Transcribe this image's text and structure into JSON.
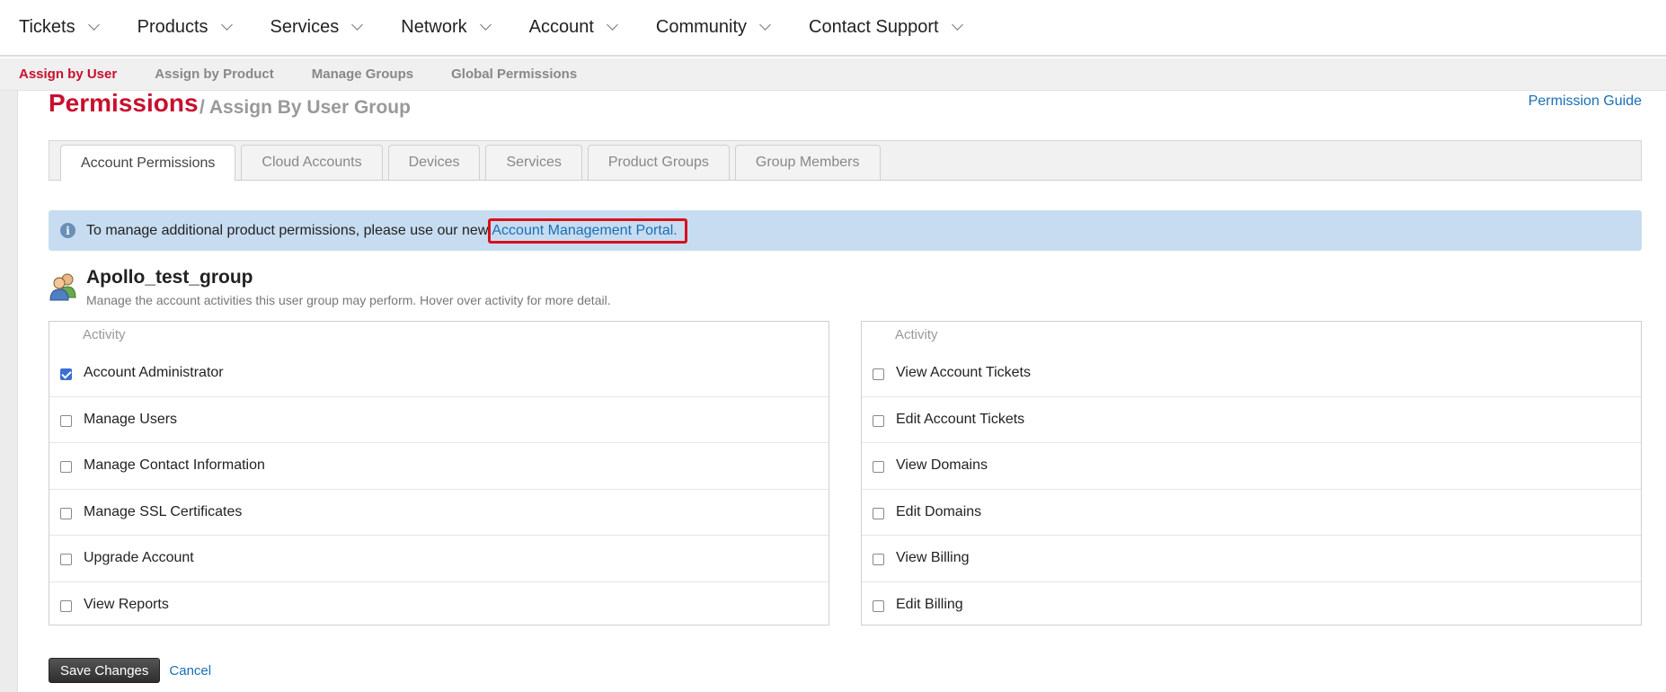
{
  "topnav": {
    "items": [
      {
        "label": "Tickets"
      },
      {
        "label": "Products"
      },
      {
        "label": "Services"
      },
      {
        "label": "Network"
      },
      {
        "label": "Account"
      },
      {
        "label": "Community"
      },
      {
        "label": "Contact Support"
      }
    ]
  },
  "subnav": {
    "items": [
      {
        "label": "Assign by User",
        "active": true
      },
      {
        "label": "Assign by Product"
      },
      {
        "label": "Manage Groups"
      },
      {
        "label": "Global Permissions"
      }
    ]
  },
  "page": {
    "title": "Permissions",
    "subtitle": "/ Assign By User Group",
    "guide_link": "Permission Guide"
  },
  "tabs": [
    {
      "label": "Account Permissions",
      "active": true
    },
    {
      "label": "Cloud Accounts"
    },
    {
      "label": "Devices"
    },
    {
      "label": "Services"
    },
    {
      "label": "Product Groups"
    },
    {
      "label": "Group Members"
    }
  ],
  "info": {
    "icon": "info-icon",
    "text": "To manage additional product permissions, please use our new",
    "link": "Account Management Portal."
  },
  "group": {
    "name": "Apollo_test_group",
    "description": "Manage the account activities this user group may perform. Hover over activity for more detail."
  },
  "left_panel": {
    "header": "Activity",
    "rows": [
      {
        "label": "Account Administrator",
        "checked": true
      },
      {
        "label": "Manage Users",
        "checked": false
      },
      {
        "label": "Manage Contact Information",
        "checked": false
      },
      {
        "label": "Manage SSL Certificates",
        "checked": false
      },
      {
        "label": "Upgrade Account",
        "checked": false
      },
      {
        "label": "View Reports",
        "checked": false
      }
    ]
  },
  "right_panel": {
    "header": "Activity",
    "rows": [
      {
        "label": "View Account Tickets",
        "checked": false
      },
      {
        "label": "Edit Account Tickets",
        "checked": false
      },
      {
        "label": "View Domains",
        "checked": false
      },
      {
        "label": "Edit Domains",
        "checked": false
      },
      {
        "label": "View Billing",
        "checked": false
      },
      {
        "label": "Edit Billing",
        "checked": false
      }
    ]
  },
  "actions": {
    "save_label": "Save Changes",
    "cancel_label": "Cancel"
  },
  "colors": {
    "brand_red": "#c8102e",
    "link_blue": "#1a6fb5",
    "info_bg": "#c7dcf0",
    "highlight_border": "#d8101c"
  }
}
